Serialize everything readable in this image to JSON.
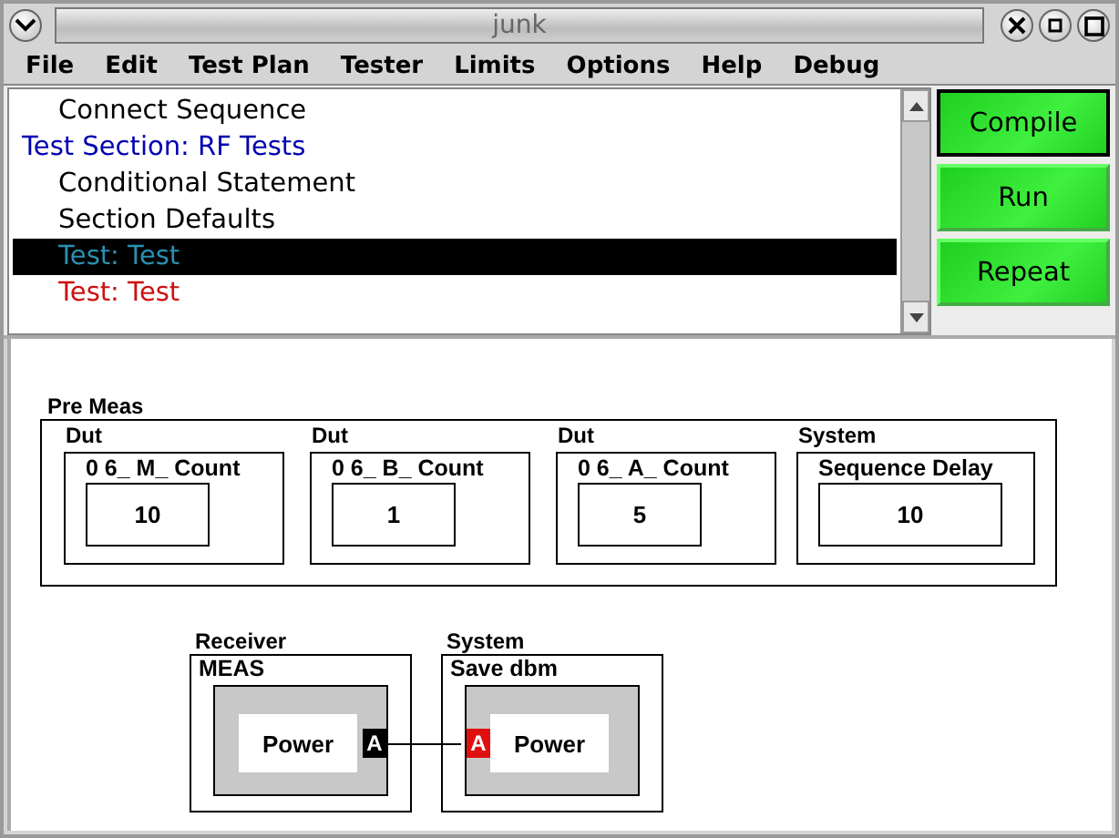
{
  "window": {
    "title": "junk"
  },
  "menu": [
    "File",
    "Edit",
    "Test Plan",
    "Tester",
    "Limits",
    "Options",
    "Help",
    "Debug"
  ],
  "outline": [
    {
      "text": "Connect Sequence",
      "kind": "item",
      "color": "#000000",
      "selected": false
    },
    {
      "text": "Test Section: RF Tests",
      "kind": "section",
      "color": "#0000b0",
      "selected": false
    },
    {
      "text": "Conditional Statement",
      "kind": "item",
      "color": "#000000",
      "selected": false
    },
    {
      "text": "Section Defaults",
      "kind": "item",
      "color": "#000000",
      "selected": false
    },
    {
      "text": "Test: Test",
      "kind": "item",
      "color": "#2a8fb0",
      "selected": true
    },
    {
      "text": "Test: Test",
      "kind": "item",
      "color": "#cc1111",
      "selected": false
    }
  ],
  "buttons": [
    "Compile",
    "Run",
    "Repeat"
  ],
  "group": {
    "label": "Pre Meas",
    "blocks": [
      {
        "category": "Dut",
        "name": "0 6_ M_ Count",
        "value": "10"
      },
      {
        "category": "Dut",
        "name": "0 6_ B_ Count",
        "value": "1"
      },
      {
        "category": "Dut",
        "name": "0 6_ A_ Count",
        "value": "5"
      },
      {
        "category": "System",
        "name": "Sequence Delay",
        "value": "10"
      }
    ]
  },
  "nodes": [
    {
      "category": "Receiver",
      "name": "MEAS",
      "function": "Power",
      "port": {
        "label": "A",
        "kind": "output",
        "color": "#000000"
      }
    },
    {
      "category": "System",
      "name": "Save dbm",
      "function": "Power",
      "port": {
        "label": "A",
        "kind": "input",
        "color": "#e01010"
      }
    }
  ]
}
